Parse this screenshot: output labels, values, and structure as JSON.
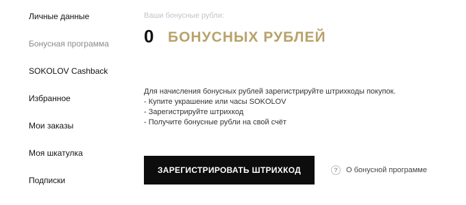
{
  "sidebar": {
    "items": [
      {
        "label": "Личные данные"
      },
      {
        "label": "Бонусная программа"
      },
      {
        "label": "SOKOLOV Cashback"
      },
      {
        "label": "Избранное"
      },
      {
        "label": "Мои заказы"
      },
      {
        "label": "Моя шкатулка"
      },
      {
        "label": "Подписки"
      }
    ],
    "active_index": 1
  },
  "bonus": {
    "caption": "Ваши бонусные рубли:",
    "amount": "0",
    "unit": "БОНУСНЫХ РУБЛЕЙ",
    "accent_color": "#b8a26a"
  },
  "info": {
    "lines": [
      "Для начисления бонусных рублей зарегистрируйте штрихкоды покупок.",
      "- Купите украшение или часы SOKOLOV",
      "- Зарегистрируйте штрихкод",
      "- Получите бонусные рубли на свой счёт"
    ]
  },
  "actions": {
    "register_label": "ЗАРЕГИСТРИРОВАТЬ ШТРИХКОД",
    "about_label": "О бонусной программе",
    "about_icon": "help-circle-icon"
  }
}
